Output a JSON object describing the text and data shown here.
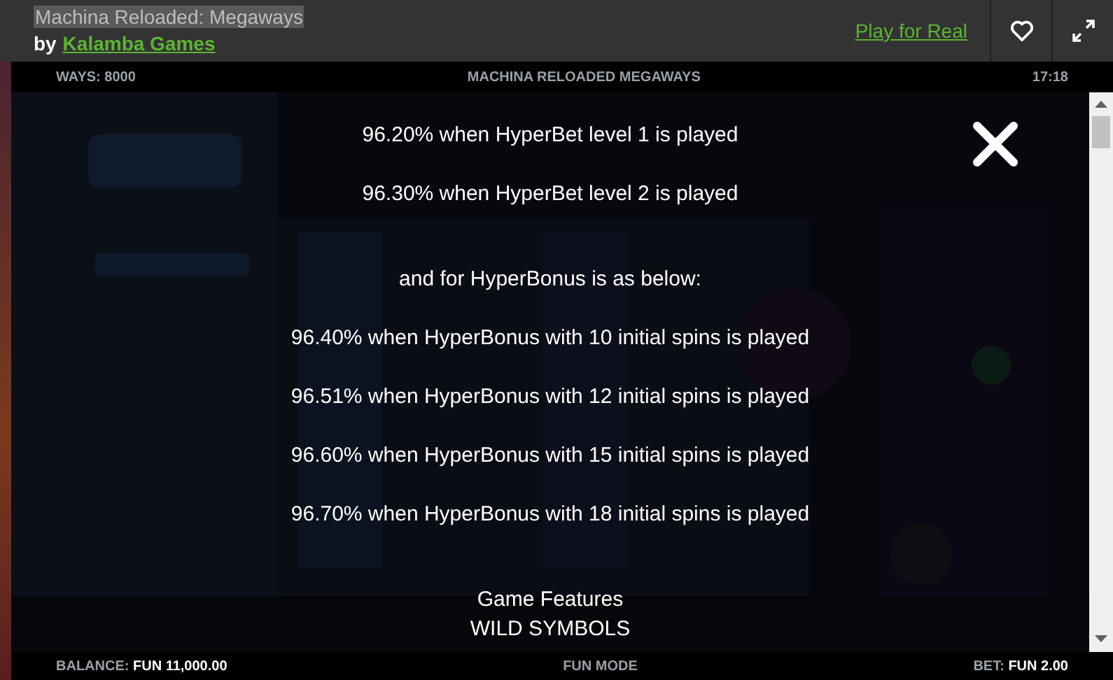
{
  "header": {
    "title": "Machina Reloaded: Megaways",
    "by": "by",
    "provider": "Kalamba Games",
    "play_link": "Play for Real"
  },
  "game_bar": {
    "ways": "WAYS: 8000",
    "title": "MACHINA RELOADED MEGAWAYS",
    "clock": "17:18"
  },
  "info_lines": [
    {
      "text": "96.20% when HyperBet level 1 is played",
      "gap_before": false
    },
    {
      "text": "96.30% when HyperBet level 2 is played",
      "gap_before": false
    },
    {
      "text": "and for HyperBonus is as below:",
      "gap_before": true
    },
    {
      "text": "96.40% when HyperBonus with 10 initial spins is played",
      "gap_before": false
    },
    {
      "text": "96.51% when HyperBonus with 12 initial spins is played",
      "gap_before": false
    },
    {
      "text": "96.60% when HyperBonus with 15 initial spins is played",
      "gap_before": false
    },
    {
      "text": "96.70% when HyperBonus with 18 initial spins is played",
      "gap_before": false
    },
    {
      "text": "Game Features",
      "gap_before": true
    },
    {
      "text": "WILD SYMBOLS",
      "gap_before": false
    }
  ],
  "status_bar": {
    "balance_label": "BALANCE:",
    "balance": "FUN 11,000.00",
    "mode": "FUN MODE",
    "bet_label": "BET:",
    "bet": "FUN 2.00"
  }
}
